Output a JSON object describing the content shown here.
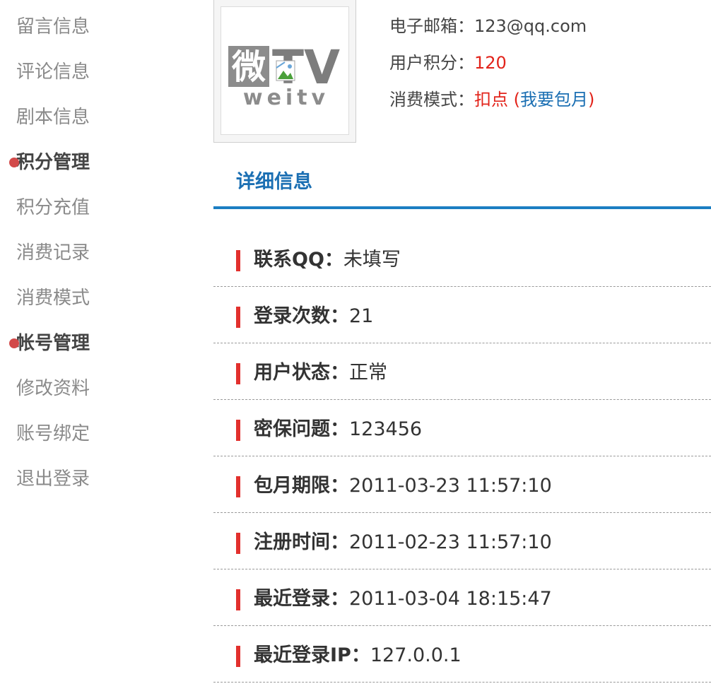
{
  "sidebar": {
    "items": [
      {
        "label": "留言信息",
        "type": "link"
      },
      {
        "label": "评论信息",
        "type": "link"
      },
      {
        "label": "剧本信息",
        "type": "link"
      },
      {
        "label": "积分管理",
        "type": "section"
      },
      {
        "label": "积分充值",
        "type": "link"
      },
      {
        "label": "消费记录",
        "type": "link"
      },
      {
        "label": "消费模式",
        "type": "link"
      },
      {
        "label": "帐号管理",
        "type": "section"
      },
      {
        "label": "修改资料",
        "type": "link"
      },
      {
        "label": "账号绑定",
        "type": "link"
      },
      {
        "label": "退出登录",
        "type": "link"
      }
    ]
  },
  "avatar": {
    "logo_main": "微TV",
    "logo_sub": "weitv",
    "icon": "broken-image-icon"
  },
  "profile": {
    "email_label": "电子邮箱：",
    "email_value": "123@qq.com",
    "points_label": "用户积分：",
    "points_value": "120",
    "mode_label": "消费模式：",
    "mode_value": "扣点",
    "mode_paren_open": " (",
    "mode_link": "我要包月",
    "mode_paren_close": ")"
  },
  "details": {
    "title": "详细信息",
    "rows": [
      {
        "label": "联系QQ：",
        "value": "未填写"
      },
      {
        "label": "登录次数：",
        "value": "21"
      },
      {
        "label": "用户状态：",
        "value": "正常"
      },
      {
        "label": "密保问题：",
        "value": "123456"
      },
      {
        "label": "包月期限：",
        "value": "2011-03-23 11:57:10"
      },
      {
        "label": "注册时间：",
        "value": "2011-02-23 11:57:10"
      },
      {
        "label": "最近登录：",
        "value": "2011-03-04 18:15:47"
      },
      {
        "label": "最近登录IP：",
        "value": "127.0.0.1"
      }
    ]
  },
  "colors": {
    "accent_blue": "#1b7ec2",
    "accent_red": "#e2231a",
    "section_dot": "#d24a4a"
  }
}
